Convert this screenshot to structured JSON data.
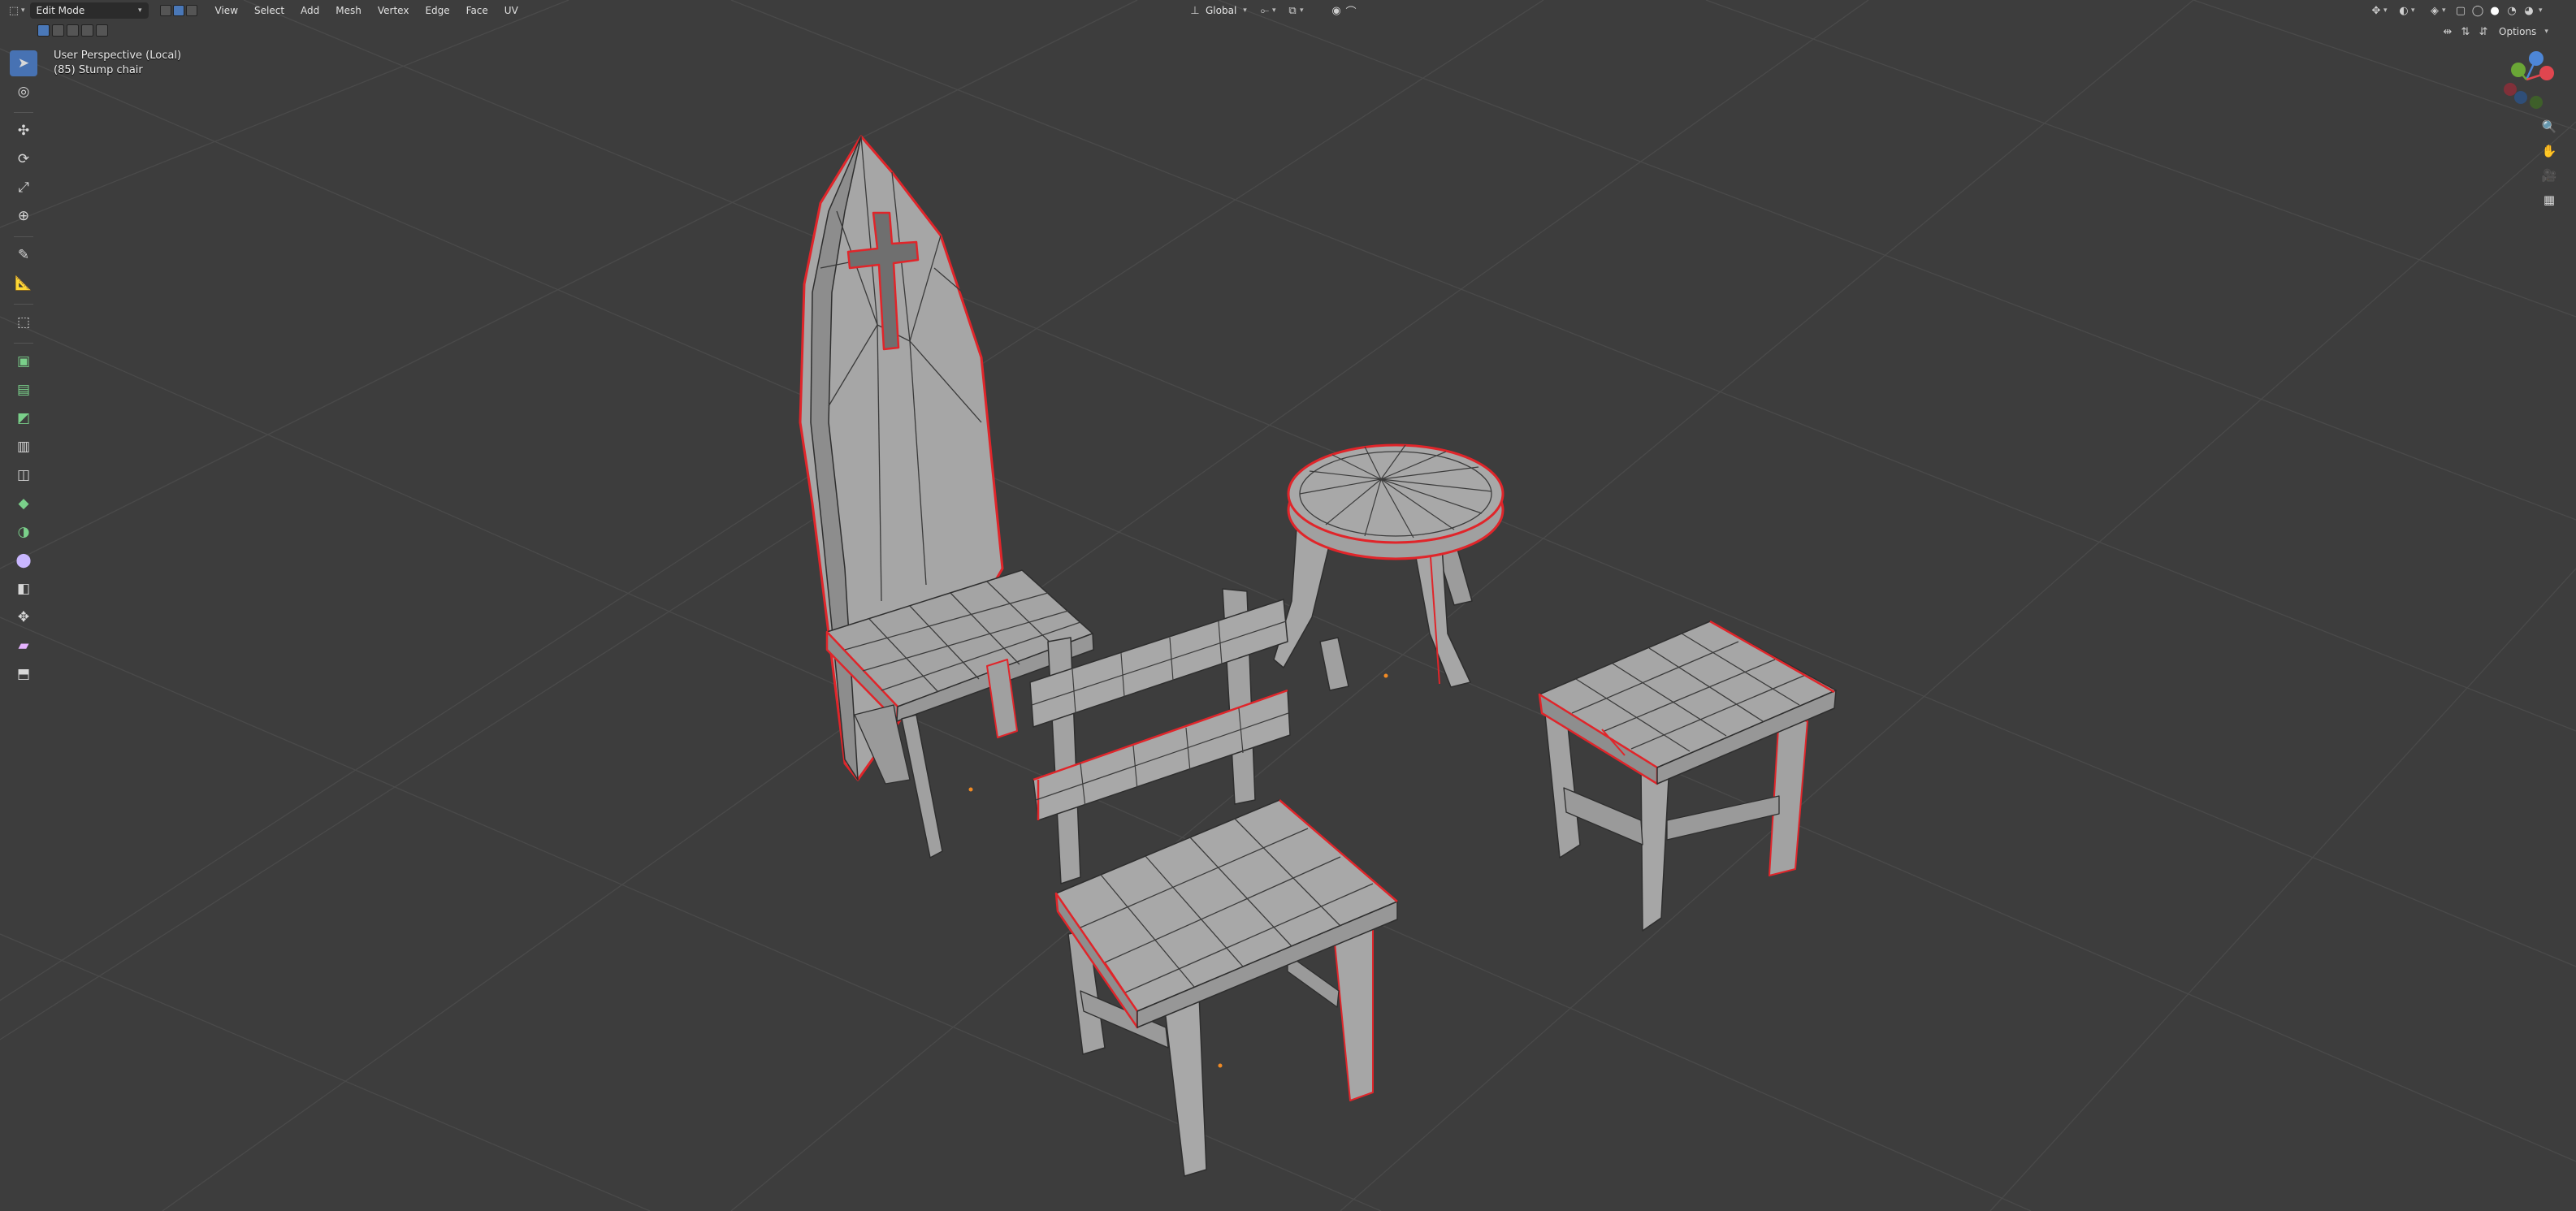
{
  "header": {
    "mode_label": "Edit Mode",
    "menus": [
      "View",
      "Select",
      "Add",
      "Mesh",
      "Vertex",
      "Edge",
      "Face",
      "UV"
    ],
    "transform_orientation": "Global",
    "options_label": "Options"
  },
  "viewport": {
    "perspective_label": "User Perspective (Local)",
    "object_label": "(85) Stump chair"
  },
  "gizmo": {
    "axes": [
      "X",
      "Y",
      "Z"
    ],
    "x_color": "#e0464f",
    "y_color": "#6aa636",
    "z_color": "#4d86d6"
  },
  "colors": {
    "background": "#3d3d3d",
    "grid": "#474747",
    "mesh_fill": "#9e9e9e",
    "mesh_edge": "#2e2e2e",
    "seam": "#e0252a",
    "active_tool": "#4772b3"
  },
  "tools": [
    "select-box",
    "cursor",
    "move",
    "rotate",
    "scale",
    "transform",
    "annotate",
    "measure",
    "add-cube",
    "extrude",
    "inset",
    "bevel",
    "loop-cut",
    "knife",
    "poly-build",
    "spin",
    "smooth",
    "edge-slide",
    "shrink-fatten",
    "shear",
    "rip-region"
  ]
}
